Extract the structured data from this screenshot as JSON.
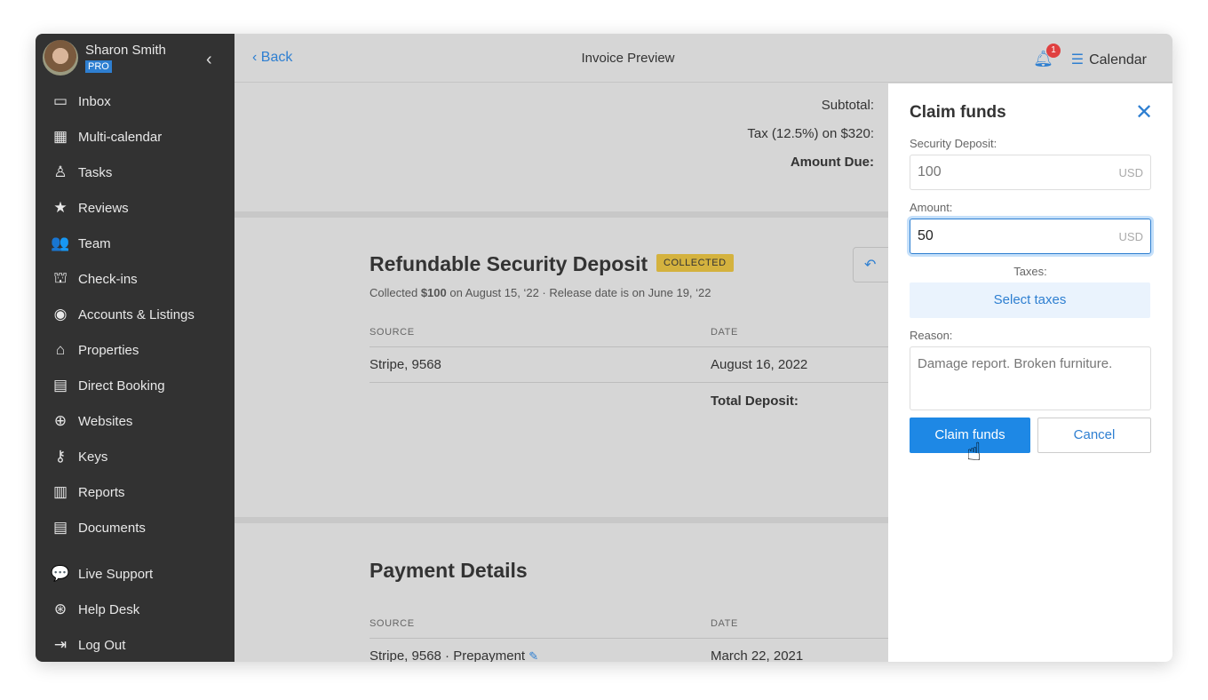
{
  "user": {
    "name": "Sharon Smith",
    "plan": "PRO"
  },
  "nav": [
    {
      "label": "Inbox",
      "icon": "inbox-icon",
      "g": "▭"
    },
    {
      "label": "Multi-calendar",
      "icon": "calendar-icon",
      "g": "▦"
    },
    {
      "label": "Tasks",
      "icon": "tasks-icon",
      "g": "♙"
    },
    {
      "label": "Reviews",
      "icon": "star-icon",
      "g": "★"
    },
    {
      "label": "Team",
      "icon": "team-icon",
      "g": "👥"
    },
    {
      "label": "Check-ins",
      "icon": "bell-desk-icon",
      "g": "⛫"
    },
    {
      "label": "Accounts & Listings",
      "icon": "account-icon",
      "g": "◉"
    },
    {
      "label": "Properties",
      "icon": "home-icon",
      "g": "⌂"
    },
    {
      "label": "Direct Booking",
      "icon": "code-window-icon",
      "g": "▤"
    },
    {
      "label": "Websites",
      "icon": "globe-icon",
      "g": "⊕"
    },
    {
      "label": "Keys",
      "icon": "key-icon",
      "g": "⚷"
    },
    {
      "label": "Reports",
      "icon": "chart-icon",
      "g": "▥"
    },
    {
      "label": "Documents",
      "icon": "document-icon",
      "g": "▤"
    }
  ],
  "nav_bottom": [
    {
      "label": "Live Support",
      "icon": "chat-icon",
      "g": "💬"
    },
    {
      "label": "Help Desk",
      "icon": "lifebuoy-icon",
      "g": "⊛"
    },
    {
      "label": "Log Out",
      "icon": "logout-icon",
      "g": "⇥"
    }
  ],
  "header": {
    "back": "Back",
    "title": "Invoice Preview",
    "notifications": "1",
    "calendar": "Calendar"
  },
  "summary": {
    "subtotal": "Subtotal:",
    "tax": "Tax (12.5%) on $320:",
    "amount_due": "Amount Due:"
  },
  "deposit": {
    "title": "Refundable Security Deposit",
    "status": "COLLECTED",
    "sub_pre": "Collected ",
    "sub_amount": "$100",
    "sub_post": " on August 15, ‘22 · Release date is on June 19, ‘22",
    "col_source": "SOURCE",
    "col_date": "DATE",
    "row_source": "Stripe, 9568",
    "row_date": "August 16, 2022",
    "total": "Total Deposit:"
  },
  "payment": {
    "title": "Payment Details",
    "col_source": "SOURCE",
    "col_date": "DATE",
    "row_source": "Stripe, 9568 · Prepayment",
    "row_date": "March 22, 2021"
  },
  "panel": {
    "title": "Claim funds",
    "deposit_label": "Security Deposit:",
    "deposit_value": "100",
    "currency": "USD",
    "amount_label": "Amount:",
    "amount_value": "50",
    "taxes_label": "Taxes:",
    "taxes_button": "Select taxes",
    "reason_label": "Reason:",
    "reason_value": "Damage report. Broken furniture.",
    "claim_button": "Claim funds",
    "cancel_button": "Cancel"
  }
}
